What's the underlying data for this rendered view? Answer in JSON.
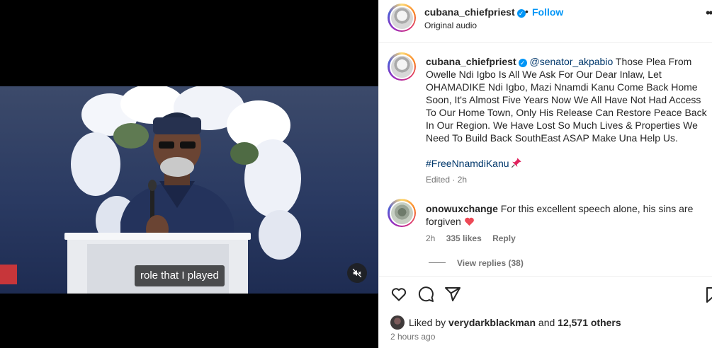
{
  "video": {
    "caption": "role that I played"
  },
  "post_header": {
    "username": "cubana_chiefpriest",
    "verified_mark": "✓",
    "separator": "•",
    "follow_label": "Follow",
    "audio": "Original audio",
    "more_label": "•••"
  },
  "post_caption": {
    "username": "cubana_chiefpriest",
    "mention": "@senator_akpabio",
    "text": "Those Plea From Owelle Ndi Igbo Is All We Ask For Our Dear Inlaw, Let OHAMADIKE Ndi Igbo, Mazi Nnamdi Kanu Come Back Home Soon, It's Almost Five Years Now We All Have Not Had Access To Our Home Town, Only His Release Can Restore Peace Back In Our Region. We Have Lost So Much Lives & Properties We Need To Build Back SouthEast ASAP Make Una Help Us.",
    "hashtag": "#FreeNnamdiKanu",
    "edited": "Edited · 2h"
  },
  "comment": {
    "username": "onowuxchange",
    "text": "For this excellent speech alone, his sins are forgiven",
    "time": "2h",
    "likes": "335 likes",
    "reply_label": "Reply",
    "view_replies": "View replies (38)"
  },
  "likes_summary": {
    "prefix": "Liked by",
    "user": "verydarkblackman",
    "joiner": "and",
    "others": "12,571 others"
  },
  "timestamp": "2 hours ago",
  "colors": {
    "link_blue": "#0095f6",
    "mention_blue": "#00376b",
    "muted": "#737373",
    "heart_red": "#ed4956"
  },
  "icons": [
    "like-heart-icon",
    "comment-icon",
    "share-icon",
    "bookmark-icon",
    "mute-icon",
    "pin-icon"
  ]
}
